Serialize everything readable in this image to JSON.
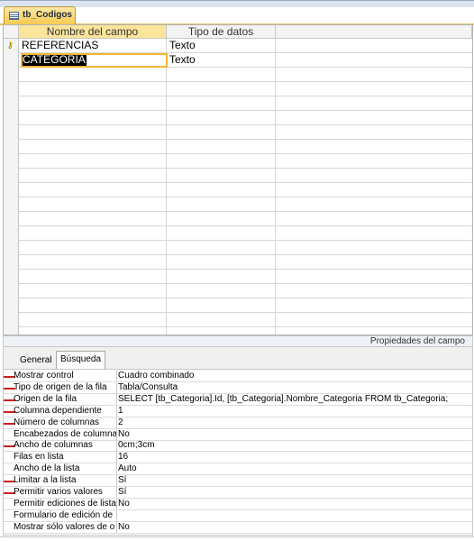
{
  "window": {
    "tab_title": "tb_Codigos"
  },
  "grid": {
    "headers": [
      "Nombre del campo",
      "Tipo de datos"
    ],
    "rows": [
      {
        "name": "REFERENCIAS",
        "type": "Texto",
        "is_key": true
      },
      {
        "name": "CATEGORIA",
        "type": "Texto",
        "selected": true
      }
    ]
  },
  "properties": {
    "bar_label": "Propiedades del campo",
    "tabs": [
      "General",
      "Búsqueda"
    ],
    "active_tab": "Búsqueda",
    "rows": [
      {
        "label": "Mostrar control",
        "value": "Cuadro combinado",
        "marked": true
      },
      {
        "label": "Tipo de origen de la fila",
        "value": "Tabla/Consulta",
        "marked": true
      },
      {
        "label": "Origen de la fila",
        "value": "SELECT [tb_Categoria].Id, [tb_Categoria].Nombre_Categoria FROM tb_Categoria;",
        "marked": true
      },
      {
        "label": "Columna dependiente",
        "value": "1",
        "marked": true
      },
      {
        "label": "Número de columnas",
        "value": "2",
        "marked": true
      },
      {
        "label": "Encabezados de columna",
        "value": "No",
        "marked": false
      },
      {
        "label": "Ancho de columnas",
        "value": "0cm;3cm",
        "marked": true
      },
      {
        "label": "Filas en lista",
        "value": "16",
        "marked": false
      },
      {
        "label": "Ancho de la lista",
        "value": "Auto",
        "marked": false
      },
      {
        "label": "Limitar a la lista",
        "value": "Sí",
        "marked": true
      },
      {
        "label": "Permitir varios valores",
        "value": "Sí",
        "marked": true
      },
      {
        "label": "Permitir ediciones de lista",
        "value": "No",
        "marked": false
      },
      {
        "label": "Formulario de edición de",
        "value": "",
        "marked": false
      },
      {
        "label": "Mostrar sólo valores de o",
        "value": "No",
        "marked": false
      }
    ]
  },
  "colors": {
    "marker": "#cc1f1f",
    "selection_outline": "#f2b632",
    "tab_gold": "#f7c951"
  }
}
